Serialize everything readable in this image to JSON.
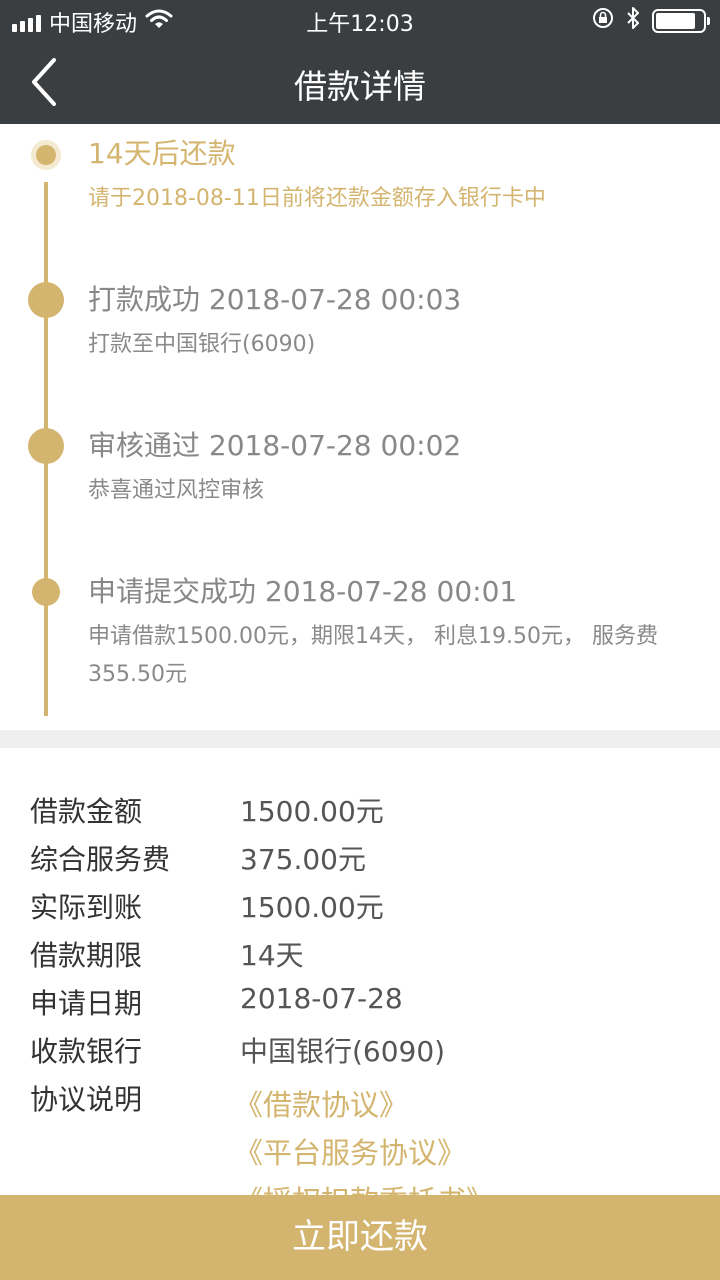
{
  "status_bar": {
    "carrier": "中国移动",
    "time": "上午12:03",
    "battery_level": 0.85
  },
  "nav": {
    "title": "借款详情"
  },
  "timeline": [
    {
      "title": "14天后还款",
      "desc": "请于2018-08-11日前将还款金额存入银行卡中"
    },
    {
      "title": "打款成功 2018-07-28 00:03",
      "desc": "打款至中国银行(6090)"
    },
    {
      "title": "审核通过 2018-07-28 00:02",
      "desc": "恭喜通过风控审核"
    },
    {
      "title": "申请提交成功 2018-07-28 00:01",
      "desc": "申请借款1500.00元，期限14天， 利息19.50元， 服务费355.50元"
    }
  ],
  "details": [
    {
      "label": "借款金额",
      "value": "1500.00元"
    },
    {
      "label": "综合服务费",
      "value": "375.00元"
    },
    {
      "label": "实际到账",
      "value": "1500.00元"
    },
    {
      "label": "借款期限",
      "value": "14天"
    },
    {
      "label": "申请日期",
      "value": "2018-07-28"
    },
    {
      "label": "收款银行",
      "value": "中国银行(6090)"
    },
    {
      "label": "协议说明",
      "value": ""
    }
  ],
  "agreements": [
    "《借款协议》",
    "《平台服务协议》",
    "《授权扣款委托书》"
  ],
  "action": {
    "repay_label": "立即还款"
  },
  "colors": {
    "accent": "#d4b56f",
    "header_bg": "#3b3e40"
  }
}
